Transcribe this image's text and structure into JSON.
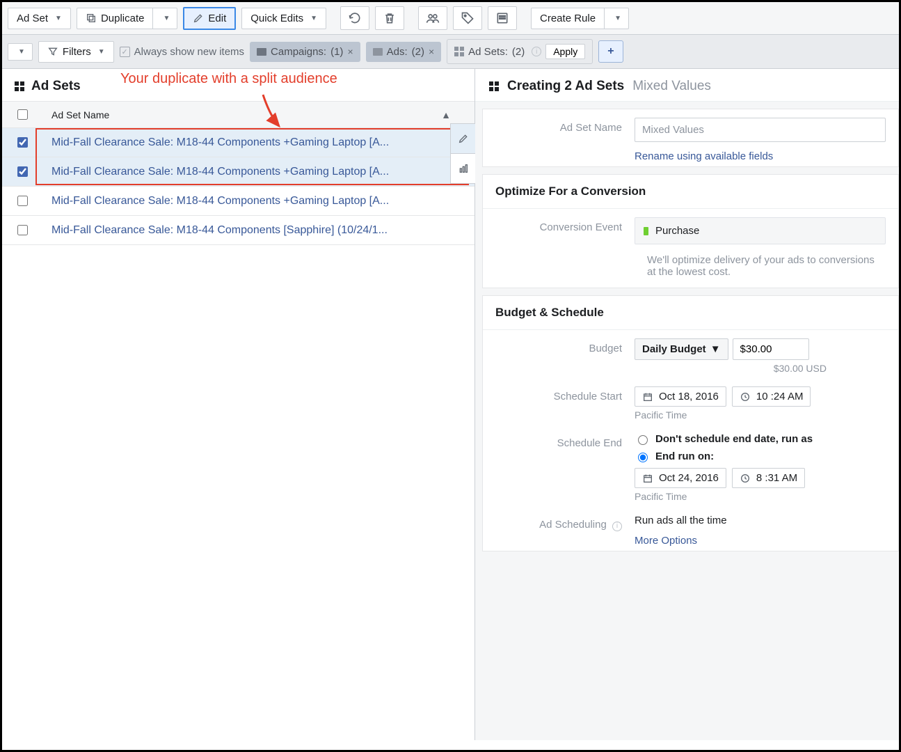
{
  "toolbar": {
    "adset_label": "Ad Set",
    "duplicate_label": "Duplicate",
    "edit_label": "Edit",
    "quick_edits_label": "Quick Edits",
    "create_rule_label": "Create Rule"
  },
  "filters": {
    "filters_label": "Filters",
    "always_show_label": "Always show new items",
    "campaigns_label": "Campaigns:",
    "campaigns_count": "(1)",
    "ads_label": "Ads:",
    "ads_count": "(2)",
    "adsets_label": "Ad Sets:",
    "adsets_count": "(2)",
    "apply_label": "Apply"
  },
  "list": {
    "title": "Ad Sets",
    "col_name": "Ad Set Name",
    "rows": [
      {
        "name": "Mid-Fall Clearance Sale: M18-44 Components +Gaming Laptop [A...",
        "checked": true
      },
      {
        "name": "Mid-Fall Clearance Sale: M18-44 Components +Gaming Laptop [A...",
        "checked": true
      },
      {
        "name": "Mid-Fall Clearance Sale: M18-44 Components +Gaming Laptop [A...",
        "checked": false
      },
      {
        "name": "Mid-Fall Clearance Sale: M18-44 Components [Sapphire] (10/24/1...",
        "checked": false
      }
    ]
  },
  "annotation": {
    "text": "Your duplicate with a split audience"
  },
  "panel": {
    "title": "Creating 2 Ad Sets",
    "subtitle": "Mixed Values",
    "adset_name_label": "Ad Set Name",
    "adset_name_value": "Mixed Values",
    "rename_link": "Rename using available fields",
    "optimize_title": "Optimize For a Conversion",
    "conversion_label": "Conversion Event",
    "conversion_value": "Purchase",
    "conversion_hint": "We'll optimize delivery of your ads to conversions at the lowest cost.",
    "budget_section": "Budget & Schedule",
    "budget_label": "Budget",
    "budget_type": "Daily Budget",
    "budget_amount": "$30.00",
    "budget_sub": "$30.00 USD",
    "sched_start_label": "Schedule Start",
    "sched_start_date": "Oct 18, 2016",
    "sched_start_time": "10 :24 AM",
    "pacific": "Pacific Time",
    "sched_end_label": "Schedule End",
    "end_opt_dont": "Don't schedule end date, run as",
    "end_opt_run": "End run on:",
    "sched_end_date": "Oct 24, 2016",
    "sched_end_time": "8 :31 AM",
    "ad_sched_label": "Ad Scheduling",
    "ad_sched_value": "Run ads all the time",
    "more_options": "More Options"
  }
}
